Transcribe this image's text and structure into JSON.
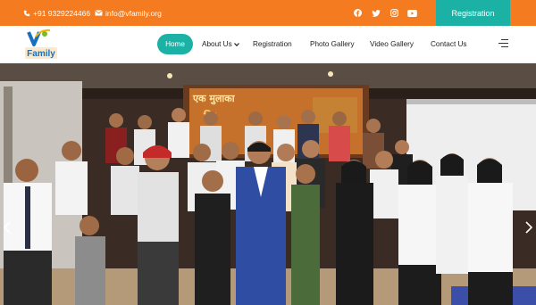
{
  "topbar": {
    "phone": "+91 9329224466",
    "email": "info@vfamily.org",
    "social_icons": [
      "facebook-icon",
      "twitter-icon",
      "instagram-icon",
      "youtube-icon"
    ],
    "registration_label": "Registration"
  },
  "logo": {
    "letter": "V",
    "word": "Family"
  },
  "nav": {
    "items": [
      {
        "label": "Home",
        "active": true
      },
      {
        "label": "About Us",
        "dropdown": true
      },
      {
        "label": "Registration"
      },
      {
        "label": "Photo Gallery"
      },
      {
        "label": "Video Gallery"
      },
      {
        "label": "Contact Us"
      }
    ]
  },
  "hero": {
    "banner_text": "एक मुलाका",
    "banner_text_2": "कि"
  },
  "colors": {
    "topbar": "#f47b20",
    "accent": "#1bb2a5",
    "text": "#222222"
  }
}
